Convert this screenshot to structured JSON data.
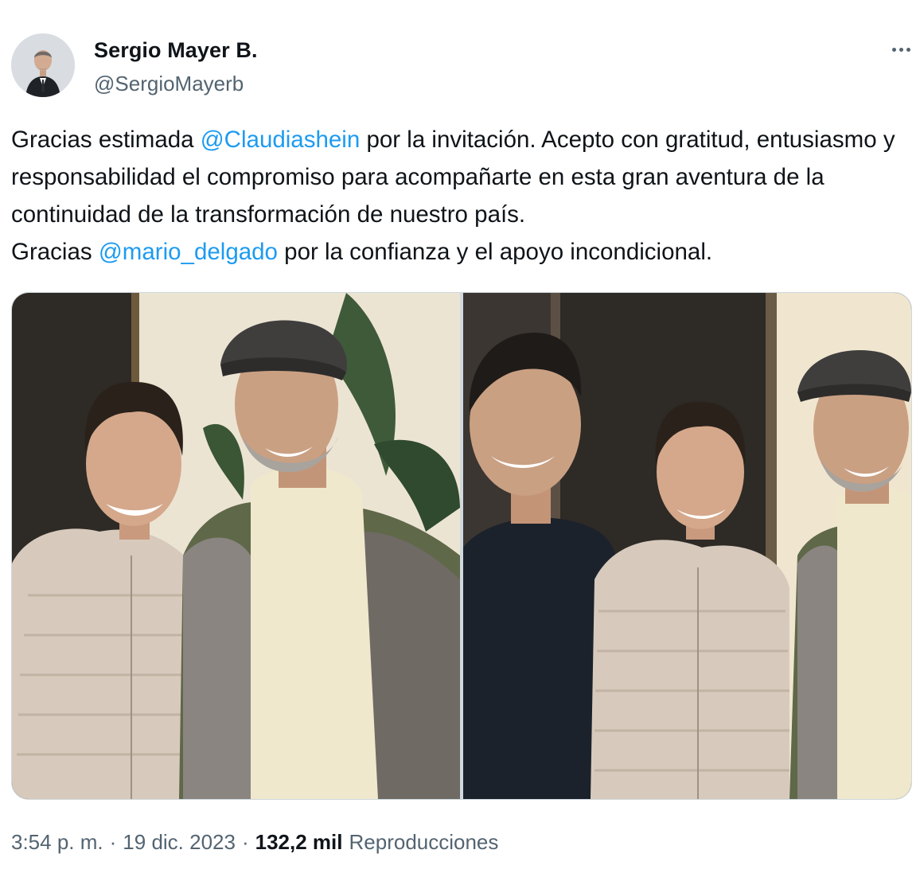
{
  "author": {
    "display_name": "Sergio Mayer B.",
    "handle": "@SergioMayerb"
  },
  "tweet": {
    "segments": [
      {
        "text": "Gracias estimada  ",
        "type": "text"
      },
      {
        "text": "@Claudiashein",
        "type": "mention"
      },
      {
        "text": " por la invitación. Acepto con gratitud, entusiasmo y responsabilidad el compromiso  para acompañarte en esta gran aventura de la continuidad de la transformación de nuestro país.\nGracias ",
        "type": "text"
      },
      {
        "text": "@mario_delgado",
        "type": "mention"
      },
      {
        "text": " por la confianza y el apoyo incondicional.",
        "type": "text"
      }
    ]
  },
  "meta": {
    "time": "3:54 p. m.",
    "separator": "·",
    "date": "19 dic. 2023",
    "views_count": "132,2 mil",
    "views_label": "Reproducciones"
  },
  "icons": {
    "more": "more-horizontal-icon"
  },
  "colors": {
    "mention": "#1d9bf0",
    "secondary_text": "#536471",
    "primary_text": "#0f1419",
    "media_border": "#cfd9de"
  }
}
